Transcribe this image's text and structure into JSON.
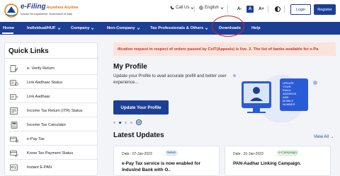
{
  "header": {
    "logo_title": "e-Filing",
    "logo_tagline": "Anywhere Anytime",
    "logo_subtitle": "Income Tax Department, Government of India",
    "call_us": "Call Us",
    "language": "English",
    "font_minus": "A-",
    "font_normal": "A",
    "font_plus": "A+",
    "login": "Login",
    "register": "Register"
  },
  "nav": {
    "items": [
      {
        "label": "Home"
      },
      {
        "label": "Individual/HUF"
      },
      {
        "label": "Company"
      },
      {
        "label": "Non-Company"
      },
      {
        "label": "Tax Professionals & Others"
      },
      {
        "label": "Downloads"
      },
      {
        "label": "Help"
      }
    ]
  },
  "quick_links": {
    "title": "Quick Links",
    "items": [
      {
        "label": "e- Verify Return"
      },
      {
        "label": "Link Aadhaar Status"
      },
      {
        "label": "Link Aadhaar"
      },
      {
        "label": "Income Tax Return (ITR) Status"
      },
      {
        "label": "Income Tax Calculator"
      },
      {
        "label": "e-Pay Tax"
      },
      {
        "label": "Know Tax Payment Status"
      },
      {
        "label": "Instant E-PAN"
      }
    ]
  },
  "ticker": "ification request in respect of orders passed by CsIT(Appeals) is live. 2. The list of banks available for e-Pa",
  "profile": {
    "title": "My Profile",
    "description": "Update your Profile to avail accurate prefill and better user experience...",
    "button": "Update Your Profile",
    "illustration_text": "UPDATE YOUR EMAIL ADDRESS AND MOBILE NUMBER"
  },
  "latest": {
    "title": "Latest Updates",
    "view_all": "View All",
    "cards": [
      {
        "date": "Date : 07-Jan-2023",
        "tag": "News",
        "body": "e-Pay Tax service is now enabled for IndusInd Bank with O.."
      },
      {
        "date": "Date : 31-Jan-2023",
        "tag": "e-Campaign",
        "body": "PAN-Aadhar Linking Campaign."
      }
    ]
  },
  "colors": {
    "brand": "#1c3f94",
    "ticker_bg": "#fbe3dc",
    "ticker_text": "#c0392b",
    "annotation_circle": "#e02020"
  }
}
